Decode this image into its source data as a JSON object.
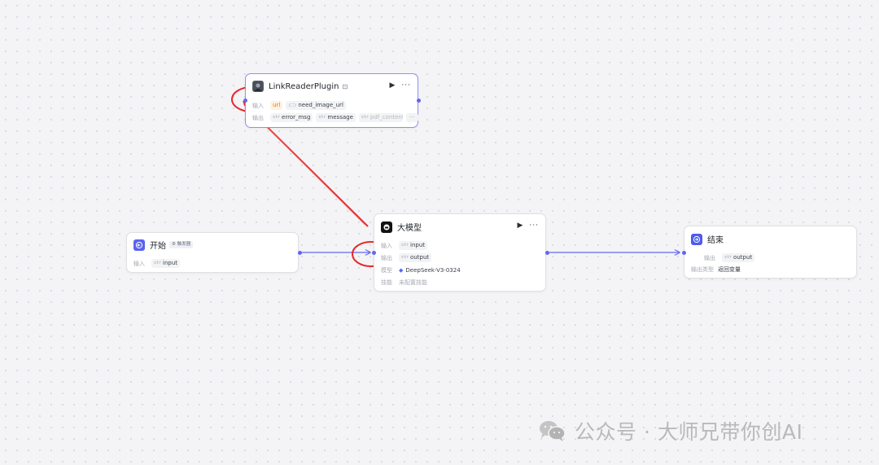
{
  "colors": {
    "accent": "#6366f1",
    "annotation": "#e8282b",
    "start_icon_bg": "#5b63ee",
    "end_icon_bg": "#4f5bea",
    "llm_icon_bg": "#111111",
    "param_orange": "#e07c12"
  },
  "nodes": {
    "plugin": {
      "title": "LinkReaderPlugin",
      "icon": "avatar-thumbnail-icon",
      "input_label": "输入",
      "inputs": [
        "url",
        "need_image_url"
      ],
      "output_label": "输出",
      "outputs": [
        "error_msg",
        "message",
        "pdf_content"
      ],
      "more": "···"
    },
    "start": {
      "title": "开始",
      "badge": "触发器",
      "icon": "start-arrow-icon",
      "input_label": "输入",
      "inputs": [
        "input"
      ]
    },
    "llm": {
      "title": "大模型",
      "icon": "llm-model-icon",
      "input_label": "输入",
      "inputs": [
        "input"
      ],
      "output_label": "输出",
      "outputs": [
        "output"
      ],
      "model_label": "模型",
      "model_value": "DeepSeek-V3-0324",
      "skill_label": "技能",
      "skill_value": "未配置技能"
    },
    "end": {
      "title": "结束",
      "icon": "end-arrow-icon",
      "output_label": "输出",
      "outputs": [
        "output"
      ],
      "output_type_label": "输出类型",
      "output_type_value": "返回变量"
    }
  },
  "type_marker": "str",
  "watermark": "公众号 · 大师兄带你创AI"
}
